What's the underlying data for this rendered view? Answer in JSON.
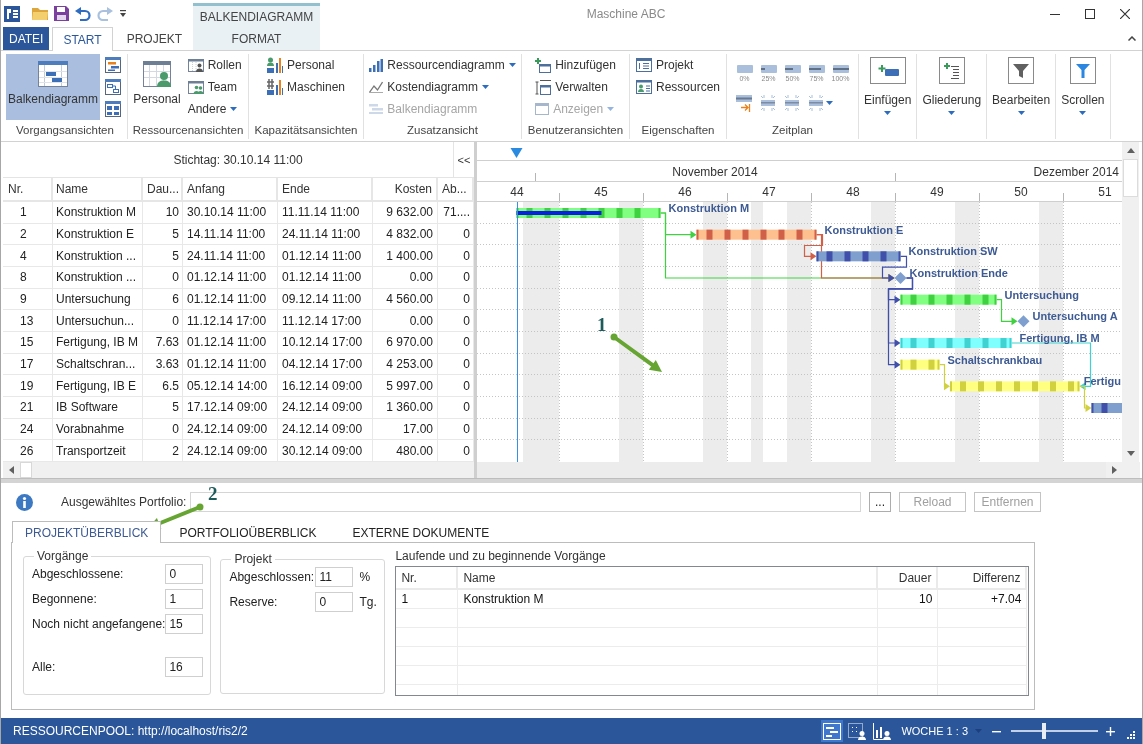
{
  "title_bar": {
    "title": "Maschine ABC",
    "context_group": "BALKENDIAGRAMM"
  },
  "ribbon_tabs": [
    {
      "label": "DATEI",
      "kind": "file",
      "selected": false
    },
    {
      "label": "START",
      "kind": "tab",
      "selected": true
    },
    {
      "label": "PROJEKT",
      "kind": "tab",
      "selected": false
    },
    {
      "label": "FORMAT",
      "kind": "context",
      "selected": false
    }
  ],
  "ribbon_groups": [
    {
      "label": "Vorgangsansichten",
      "buttons": [
        {
          "kind": "large",
          "label": "Balkendiagramm",
          "selected": true,
          "disabled": false
        },
        {
          "kind": "icon",
          "selected": false,
          "disabled": false
        },
        {
          "kind": "icon",
          "selected": false,
          "disabled": false
        },
        {
          "kind": "icon",
          "selected": false,
          "disabled": false
        }
      ]
    },
    {
      "label": "Ressourcenansichten",
      "buttons": [
        {
          "kind": "large",
          "label": "Personal",
          "selected": false,
          "disabled": false
        },
        {
          "kind": "small",
          "label": "Rollen",
          "selected": false,
          "disabled": false
        },
        {
          "kind": "small",
          "label": "Team",
          "selected": false,
          "disabled": false
        },
        {
          "kind": "menu",
          "label": "Andere",
          "selected": false,
          "disabled": false
        }
      ]
    },
    {
      "label": "Kapazitätsansichten",
      "buttons": [
        {
          "kind": "small",
          "label": "Personal",
          "selected": false,
          "disabled": false
        },
        {
          "kind": "small",
          "label": "Maschinen",
          "selected": false,
          "disabled": false
        }
      ]
    },
    {
      "label": "Zusatzansicht",
      "buttons": [
        {
          "kind": "menu",
          "label": "Ressourcendiagramm",
          "disabled": false
        },
        {
          "kind": "menu",
          "label": "Kostendiagramm",
          "disabled": false
        },
        {
          "kind": "small",
          "label": "Balkendiagramm",
          "disabled": true
        }
      ]
    },
    {
      "label": "Benutzeransichten",
      "buttons": [
        {
          "kind": "small",
          "label": "Hinzufügen",
          "disabled": false
        },
        {
          "kind": "small",
          "label": "Verwalten",
          "disabled": false
        },
        {
          "kind": "menu",
          "label": "Anzeigen",
          "disabled": true
        }
      ]
    },
    {
      "label": "Eigenschaften",
      "buttons": [
        {
          "kind": "small",
          "label": "Projekt",
          "disabled": false
        },
        {
          "kind": "small",
          "label": "Ressourcen",
          "disabled": false
        }
      ]
    },
    {
      "label": "Zeitplan",
      "buttons": [
        {
          "kind": "percent",
          "label": "0%",
          "disabled": false
        },
        {
          "kind": "percent",
          "label": "25%",
          "disabled": false
        },
        {
          "kind": "percent",
          "label": "50%",
          "disabled": false
        },
        {
          "kind": "percent",
          "label": "75%",
          "disabled": false
        },
        {
          "kind": "percent",
          "label": "100%",
          "disabled": false
        },
        {
          "kind": "icon",
          "disabled": false
        },
        {
          "kind": "icon",
          "disabled": false
        },
        {
          "kind": "icon",
          "disabled": false
        },
        {
          "kind": "icon_menu",
          "disabled": false
        }
      ]
    },
    {
      "buttons": [
        {
          "kind": "tall",
          "label": "Einfügen",
          "disabled": false
        }
      ]
    },
    {
      "buttons": [
        {
          "kind": "tall",
          "label": "Gliederung",
          "disabled": false
        }
      ]
    },
    {
      "buttons": [
        {
          "kind": "tall",
          "label": "Bearbeiten",
          "disabled": false
        }
      ]
    },
    {
      "buttons": [
        {
          "kind": "tall",
          "label": "Scrollen",
          "disabled": false
        }
      ]
    }
  ],
  "tasks": {
    "reference_date": "Stichtag: 30.10.14 11:00",
    "collapse_button": "<<",
    "columns": [
      "Nr.",
      "Name",
      "Dau...",
      "Anfang",
      "Ende",
      "Kosten",
      "Ab..."
    ],
    "rows": [
      {
        "cells": [
          "1",
          "Konstruktion M",
          "10",
          "30.10.14 11:00",
          "11.11.14 11:00",
          "9 632.00",
          "71...."
        ]
      },
      {
        "cells": [
          "2",
          "Konstruktion E",
          "5",
          "14.11.14 11:00",
          "24.11.14 11:00",
          "4 832.00",
          "0"
        ]
      },
      {
        "cells": [
          "4",
          "Konstruktion ...",
          "5",
          "24.11.14 11:00",
          "01.12.14 11:00",
          "1 400.00",
          "0"
        ]
      },
      {
        "cells": [
          "8",
          "Konstruktion ...",
          "0",
          "01.12.14 11:00",
          "01.12.14 11:00",
          "0.00",
          "0"
        ]
      },
      {
        "cells": [
          "9",
          "Untersuchung",
          "6",
          "01.12.14 11:00",
          "09.12.14 11:00",
          "4 560.00",
          "0"
        ]
      },
      {
        "cells": [
          "13",
          "Untersuchun...",
          "0",
          "11.12.14 17:00",
          "11.12.14 17:00",
          "0.00",
          "0"
        ]
      },
      {
        "cells": [
          "15",
          "Fertigung, IB M",
          "7.63",
          "01.12.14 11:00",
          "10.12.14 17:00",
          "6 970.00",
          "0"
        ]
      },
      {
        "cells": [
          "17",
          "Schaltschran...",
          "3.63",
          "01.12.14 11:00",
          "04.12.14 17:00",
          "4 253.00",
          "0"
        ]
      },
      {
        "cells": [
          "19",
          "Fertigung, IB E",
          "6.5",
          "05.12.14 14:00",
          "16.12.14 09:00",
          "5 997.00",
          "0"
        ]
      },
      {
        "cells": [
          "21",
          "IB Software",
          "5",
          "17.12.14 09:00",
          "24.12.14 09:00",
          "1 360.00",
          "0"
        ]
      },
      {
        "cells": [
          "24",
          "Vorabnahme",
          "0",
          "24.12.14 09:00",
          "24.12.14 09:00",
          "17.00",
          "0"
        ]
      },
      {
        "cells": [
          "26",
          "Transportzeit",
          "2",
          "24.12.14 09:00",
          "30.12.14 09:00",
          "480.00",
          "0"
        ]
      }
    ]
  },
  "gantt": {
    "months": [
      "November 2014",
      "Dezember 2014"
    ],
    "weeks": [
      "44",
      "45",
      "46",
      "47",
      "48",
      "49",
      "50",
      "51"
    ],
    "bars": [
      {
        "kind": "bar",
        "label": "Konstruktion M",
        "color": "#80ff80",
        "level": 0.59
      },
      {
        "kind": "bar",
        "label": "Konstruktion E",
        "color": "#ffc090"
      },
      {
        "kind": "bar",
        "label": "Konstruktion SW",
        "color": "#7f9fcf"
      },
      {
        "kind": "milestone",
        "label": "Konstruktion Ende",
        "color": "#7f9fcf"
      },
      {
        "kind": "bar",
        "label": "Untersuchung",
        "color": "#80ff80"
      },
      {
        "kind": "milestone",
        "label": "Untersuchung A",
        "color": "#7f9fcf"
      },
      {
        "kind": "bar",
        "label": "Fertigung, IB M",
        "color": "#80ffff"
      },
      {
        "kind": "bar",
        "label": "Schaltschrankbau",
        "color": "#ffff80"
      },
      {
        "kind": "bar",
        "label": "Fertigu",
        "color": "#ffff80"
      },
      {
        "kind": "bar",
        "color": "#7f9fcf"
      }
    ]
  },
  "portfolio": {
    "label": "Ausgewähltes Portfolio:",
    "buttons": [
      {
        "label": "...",
        "disabled": false
      },
      {
        "label": "Reload",
        "disabled": true
      },
      {
        "label": "Entfernen",
        "disabled": true
      }
    ]
  },
  "detail_tabs": [
    {
      "label": "PROJEKTÜBERBLICK",
      "selected": true
    },
    {
      "label": "PORTFOLIOÜBERBLICK",
      "selected": false
    },
    {
      "label": "EXTERNE DOKUMENTE",
      "selected": false
    }
  ],
  "overview": {
    "task_counts": {
      "title": "Vorgänge",
      "fields": [
        {
          "kind": "count",
          "label": "Abgeschlossene:",
          "value": "0"
        },
        {
          "kind": "count",
          "label": "Begonnene:",
          "value": "1"
        },
        {
          "kind": "count",
          "label": "Noch nicht angefangene:",
          "value": "15"
        },
        {
          "kind": "total",
          "label": "Alle:",
          "value": "16"
        }
      ]
    },
    "project": {
      "title": "Projekt",
      "fields": [
        {
          "label": "Abgeschlossen:",
          "value": "11",
          "unit": "%"
        },
        {
          "label": "Reserve:",
          "value": "0",
          "unit": "Tg."
        }
      ]
    },
    "running_tasks": {
      "title": "Laufende und zu beginnende Vorgänge",
      "columns": [
        "Nr.",
        "Name",
        "Dauer",
        "Differenz"
      ],
      "rows": [
        {
          "cells": [
            "1",
            "Konstruktion M",
            "10",
            "+7.04"
          ]
        }
      ]
    }
  },
  "status_bar": {
    "text": "RESSOURCENPOOL: http://localhost/ris2/2",
    "views": [
      {
        "selected": true
      },
      {
        "selected": false
      },
      {
        "selected": false
      }
    ],
    "zoom_label": "WOCHE 1 : 3",
    "zoom_slider": {
      "level": 0.38
    }
  },
  "callouts": [
    {
      "label": "1"
    },
    {
      "label": "2"
    }
  ]
}
